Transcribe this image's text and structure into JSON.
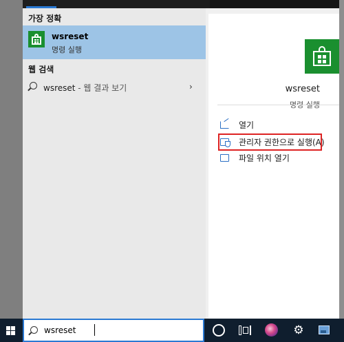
{
  "best_match": {
    "header": "가장 정확",
    "item": {
      "title": "wsreset",
      "subtitle": "명령 실행"
    }
  },
  "web_search": {
    "header": "웹 검색",
    "item": {
      "query": "wsreset",
      "suffix": " - 웹 결과 보기",
      "chevron": "›"
    }
  },
  "details": {
    "title": "wsreset",
    "subtitle": "명령 실행",
    "actions": [
      {
        "label": "열기",
        "icon": "open-icon"
      },
      {
        "label": "관리자 권한으로 실행(A)",
        "icon": "run-as-admin-icon",
        "highlighted": true
      },
      {
        "label": "파일 위치 열기",
        "icon": "folder-icon"
      }
    ]
  },
  "taskbar": {
    "search_value": "wsreset",
    "icons": [
      "windows-start-icon",
      "search-icon",
      "cortana-icon",
      "task-view-icon",
      "browser-app-icon",
      "settings-gear-icon",
      "photos-icon"
    ],
    "gear_glyph": "⚙"
  },
  "colors": {
    "selection": "#9dc4e6",
    "app_tile": "#1a8f2f",
    "highlight_border": "#dd2222",
    "taskbar": "#0f1e2e",
    "accent": "#2a79d3"
  }
}
